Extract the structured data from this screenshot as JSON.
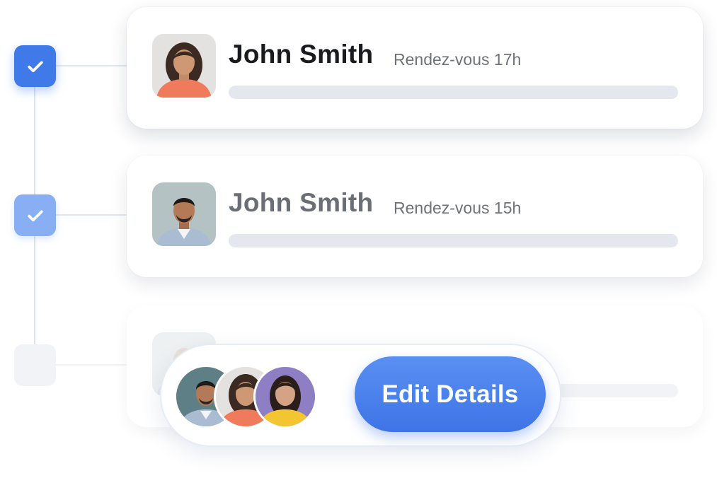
{
  "appointments": [
    {
      "name": "John Smith",
      "time": "Rendez-vous 17h",
      "status": "checked"
    },
    {
      "name": "John Smith",
      "time": "Rendez-vous 15h",
      "status": "checked-light"
    },
    {
      "name": "",
      "time": "",
      "status": "unchecked"
    }
  ],
  "action": {
    "edit_label": "Edit Details"
  },
  "icons": [
    "check-icon",
    "avatar",
    "avatar-group"
  ],
  "colors": {
    "accent": "#3f7ae8",
    "accent_light": "#88aef3",
    "placeholder": "#e4e8ee"
  }
}
